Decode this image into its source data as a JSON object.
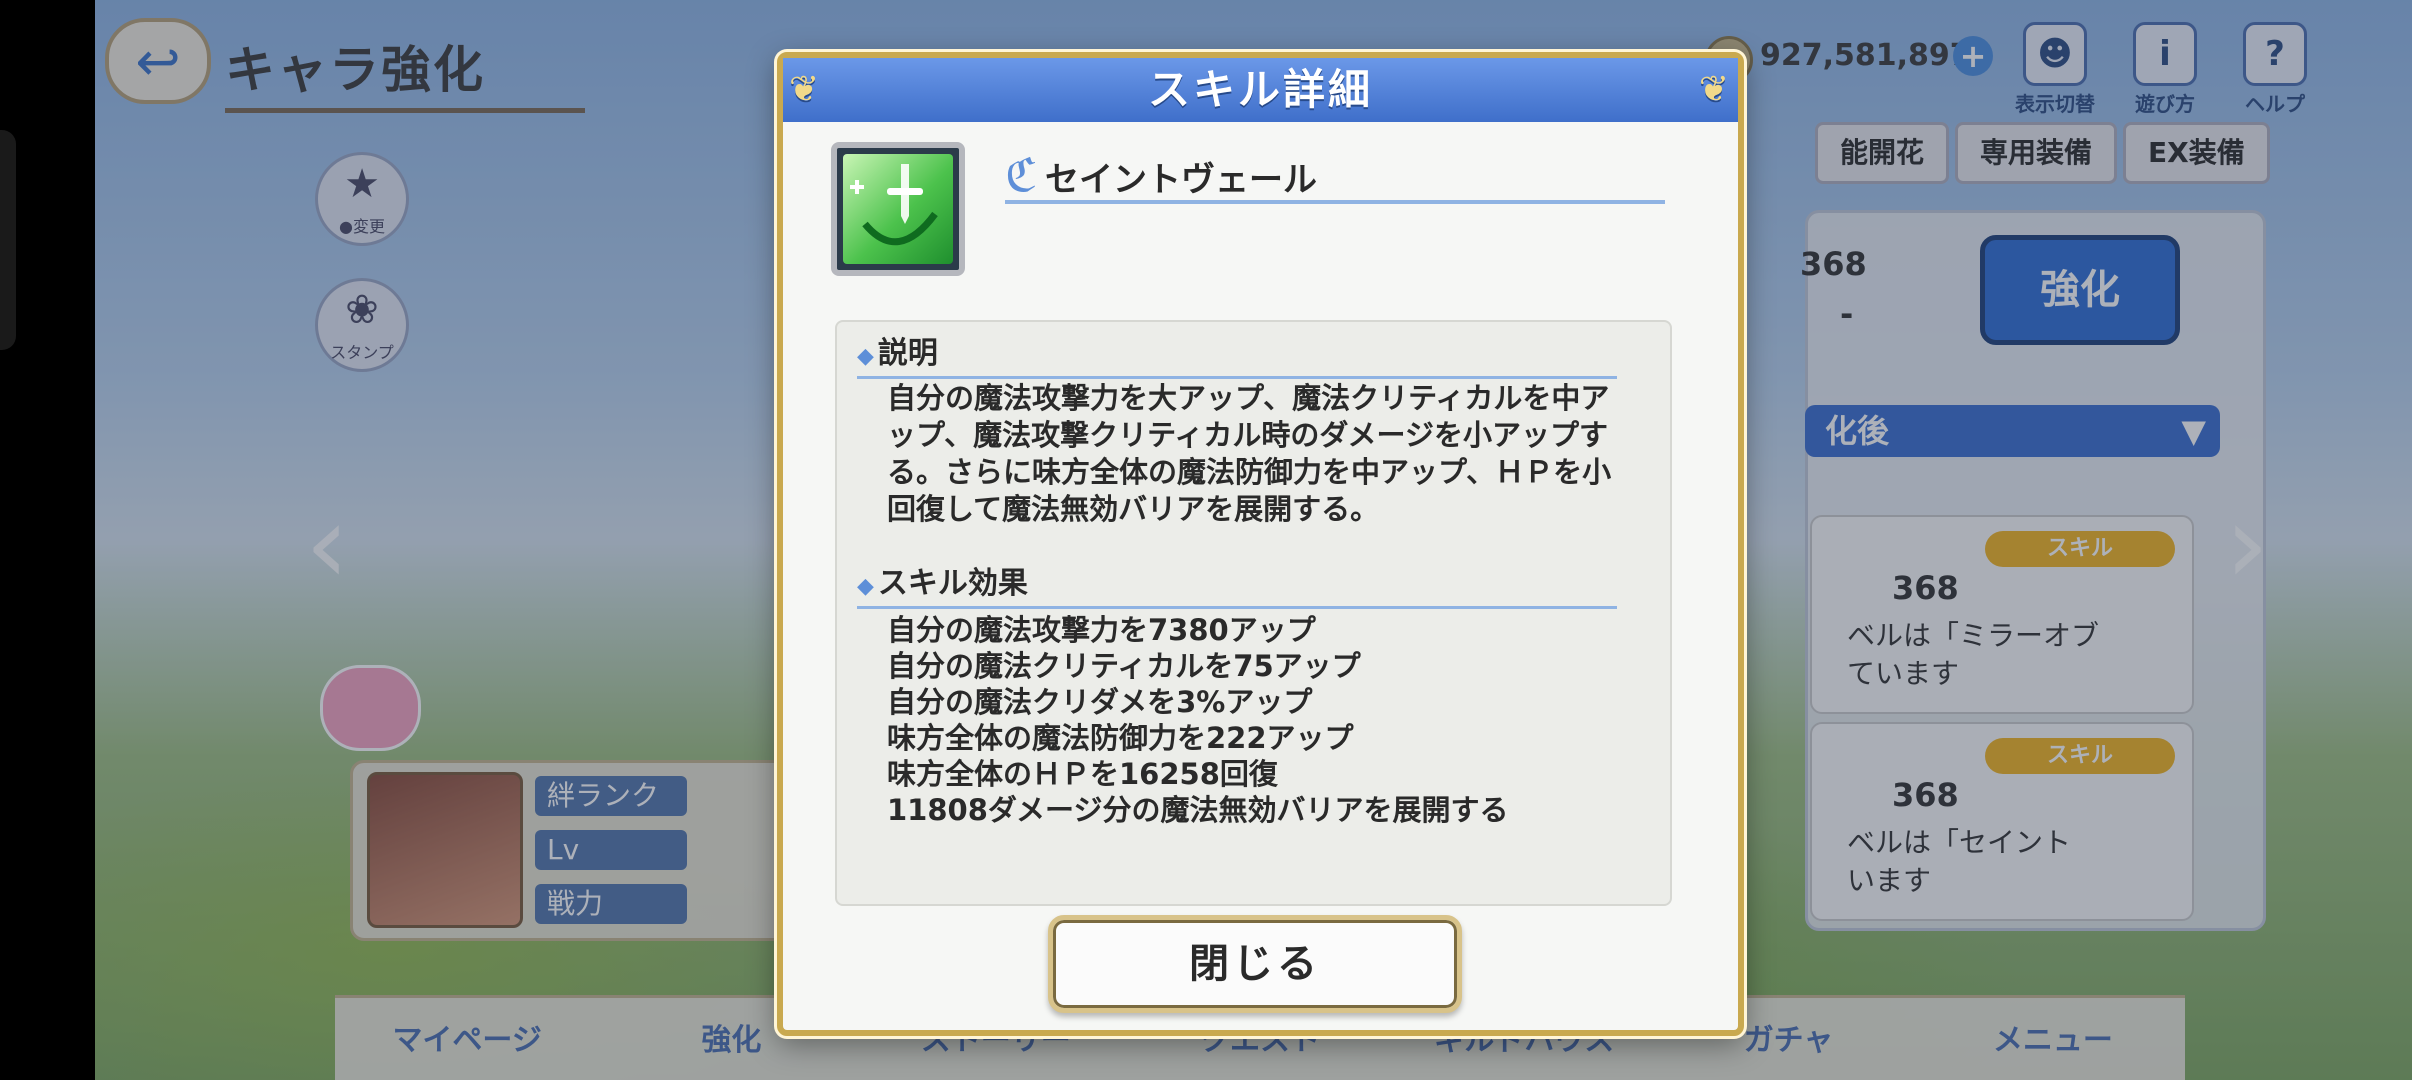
{
  "header": {
    "back_label": "↩",
    "title": "キャラ強化",
    "money": "927,581,897",
    "money_plus": "+",
    "top_icons": [
      {
        "icon": "display-switch-icon",
        "glyph": "☻",
        "label": "表示切替"
      },
      {
        "icon": "how-to-play-icon",
        "glyph": "i",
        "label": "遊び方"
      },
      {
        "icon": "help-icon",
        "glyph": "?",
        "label": "ヘルプ"
      }
    ]
  },
  "left_icons": [
    {
      "icon": "star-icon",
      "glyph": "★",
      "label": "●変更"
    },
    {
      "icon": "stamp-icon",
      "glyph": "❀",
      "label": "スタンプ"
    }
  ],
  "tabs": [
    "能開花",
    "専用装備",
    "EX装備"
  ],
  "right_panel": {
    "level_value": "368",
    "dash": "-",
    "enhance_label": "強化",
    "section_label": "化後",
    "section_arrow": "▼",
    "cards": [
      {
        "pill": "スキル",
        "level": "368",
        "text_line1": "ベルは「ミラーオブ",
        "text_line2": "ています"
      },
      {
        "pill": "スキル",
        "level": "368",
        "text_line1": "ベルは「セイント",
        "text_line2": "います"
      }
    ]
  },
  "char_box": {
    "stats": [
      "絆ランク",
      "Lv",
      "戦力"
    ]
  },
  "bottom_nav": [
    "マイページ",
    "強化",
    "ストーリー",
    "クエスト",
    "ギルドハウス",
    "ガチャ",
    "メニュー"
  ],
  "modal": {
    "title": "スキル詳細",
    "skill_name": "セイントヴェール",
    "description_heading": "説明",
    "description": "自分の魔法攻撃力を大アップ、魔法クリティカルを中アップ、魔法攻撃クリティカル時のダメージを小アップする。さらに味方全体の魔法防御力を中アップ、ＨＰを小回復して魔法無効バリアを展開する。",
    "effects_heading": "スキル効果",
    "effects": [
      "自分の魔法攻撃力を7380アップ",
      "自分の魔法クリティカルを75アップ",
      "自分の魔法クリダメを3%アップ",
      "味方全体の魔法防御力を222アップ",
      "味方全体のＨＰを16258回復",
      "11808ダメージ分の魔法無効バリアを展開する"
    ],
    "close_label": "閉じる"
  }
}
